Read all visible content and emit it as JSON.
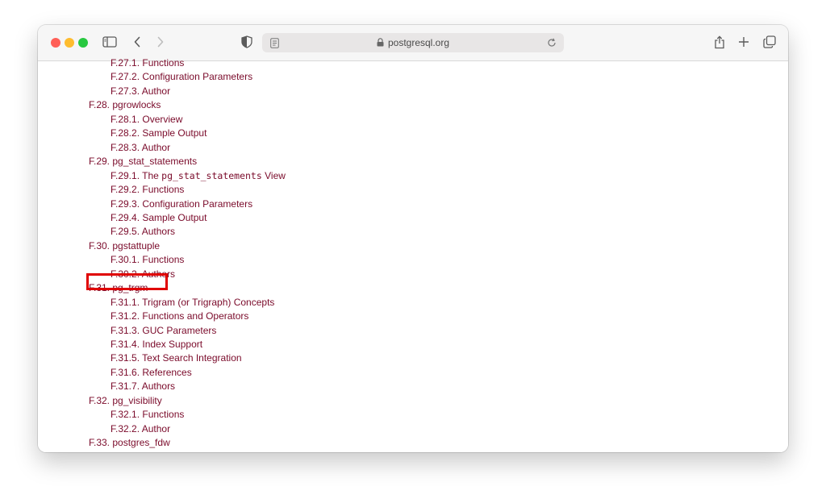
{
  "browser": {
    "url": "postgresql.org",
    "colors": {
      "link": "#7a0a2a",
      "highlight": "#e00000"
    }
  },
  "toc": [
    {
      "level": 2,
      "number": "F.27.1.",
      "text": "Functions"
    },
    {
      "level": 2,
      "number": "F.27.2.",
      "text": "Configuration Parameters"
    },
    {
      "level": 2,
      "number": "F.27.3.",
      "text": "Author"
    },
    {
      "level": 1,
      "number": "F.28.",
      "text": "pgrowlocks"
    },
    {
      "level": 2,
      "number": "F.28.1.",
      "text": "Overview"
    },
    {
      "level": 2,
      "number": "F.28.2.",
      "text": "Sample Output"
    },
    {
      "level": 2,
      "number": "F.28.3.",
      "text": "Author"
    },
    {
      "level": 1,
      "number": "F.29.",
      "text": "pg_stat_statements"
    },
    {
      "level": 2,
      "number": "F.29.1.",
      "text_pre": "The",
      "code": "pg_stat_statements",
      "text_post": "View"
    },
    {
      "level": 2,
      "number": "F.29.2.",
      "text": "Functions"
    },
    {
      "level": 2,
      "number": "F.29.3.",
      "text": "Configuration Parameters"
    },
    {
      "level": 2,
      "number": "F.29.4.",
      "text": "Sample Output"
    },
    {
      "level": 2,
      "number": "F.29.5.",
      "text": "Authors"
    },
    {
      "level": 1,
      "number": "F.30.",
      "text": "pgstattuple",
      "highlighted": true
    },
    {
      "level": 2,
      "number": "F.30.1.",
      "text": "Functions"
    },
    {
      "level": 2,
      "number": "F.30.2.",
      "text": "Authors"
    },
    {
      "level": 1,
      "number": "F.31.",
      "text": "pg_trgm"
    },
    {
      "level": 2,
      "number": "F.31.1.",
      "text": "Trigram (or Trigraph) Concepts"
    },
    {
      "level": 2,
      "number": "F.31.2.",
      "text": "Functions and Operators"
    },
    {
      "level": 2,
      "number": "F.31.3.",
      "text": "GUC Parameters"
    },
    {
      "level": 2,
      "number": "F.31.4.",
      "text": "Index Support"
    },
    {
      "level": 2,
      "number": "F.31.5.",
      "text": "Text Search Integration"
    },
    {
      "level": 2,
      "number": "F.31.6.",
      "text": "References"
    },
    {
      "level": 2,
      "number": "F.31.7.",
      "text": "Authors"
    },
    {
      "level": 1,
      "number": "F.32.",
      "text": "pg_visibility"
    },
    {
      "level": 2,
      "number": "F.32.1.",
      "text": "Functions"
    },
    {
      "level": 2,
      "number": "F.32.2.",
      "text": "Author"
    },
    {
      "level": 1,
      "number": "F.33.",
      "text": "postgres_fdw"
    }
  ]
}
